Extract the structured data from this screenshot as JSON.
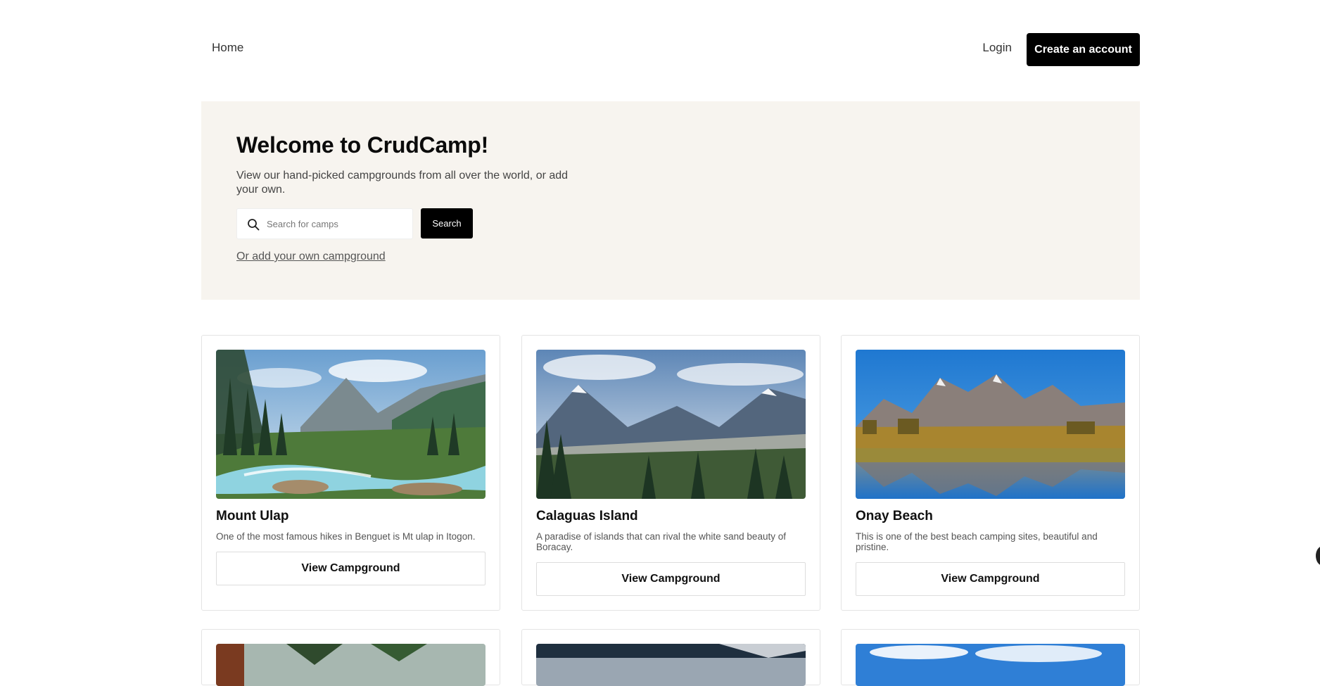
{
  "nav": {
    "home_label": "Home",
    "login_label": "Login",
    "create_account_label": "Create an account"
  },
  "hero": {
    "title": "Welcome to CrudCamp!",
    "subtitle": "View our hand-picked campgrounds from all over the world, or add your own.",
    "search": {
      "placeholder": "Search for camps",
      "value": "",
      "button_label": "Search",
      "icon": "search-icon"
    },
    "add_link_label": "Or add your own campground"
  },
  "campgrounds": [
    {
      "name": "Mount Ulap",
      "description": "One of the most famous hikes in Benguet is Mt ulap in Itogon.",
      "button_label": "View Campground"
    },
    {
      "name": "Calaguas Island",
      "description": "A paradise of islands that can rival the white sand beauty of Boracay.",
      "button_label": "View Campground"
    },
    {
      "name": "Onay Beach",
      "description": "This is one of the best beach camping sites, beautiful and pristine.",
      "button_label": "View Campground"
    }
  ],
  "colors": {
    "hero_background": "#f7f4ef",
    "primary_button": "#000000",
    "primary_button_text": "#ffffff",
    "card_border": "#e4e4e4"
  }
}
